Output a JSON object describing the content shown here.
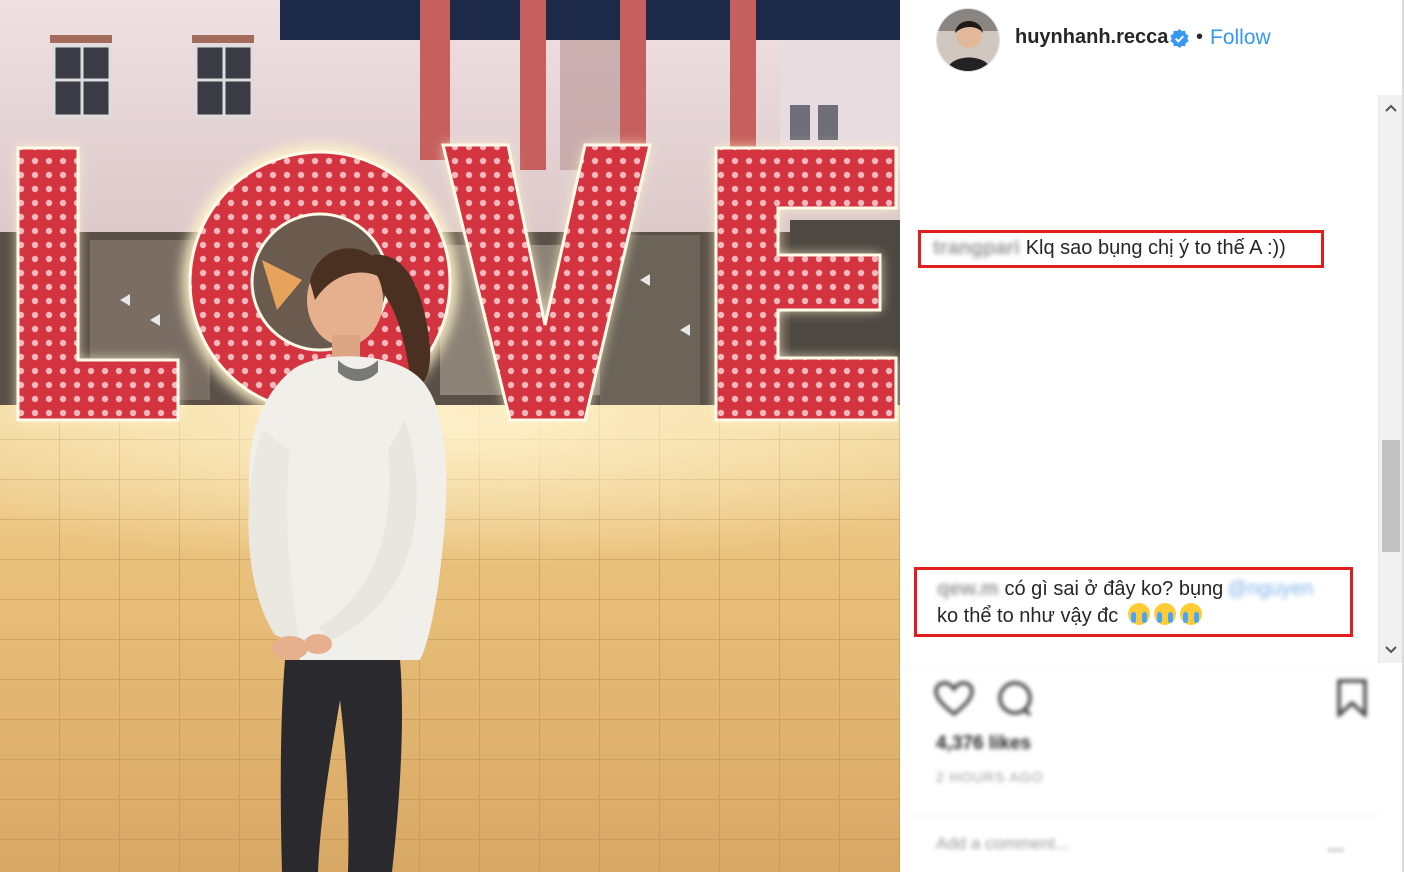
{
  "photo": {
    "sign_letters": [
      "L",
      "O",
      "V",
      "E"
    ],
    "palette": {
      "neon_red": "#d9333b",
      "glow": "#fff3c8",
      "floor": "#e8c07d",
      "building": "#e6cfcf",
      "sky": "#3a4a7a"
    }
  },
  "header": {
    "username": "huynhanh.recca",
    "separator": "•",
    "follow_label": "Follow",
    "verified_icon": "verified-badge-icon",
    "follow_color": "#3897f0"
  },
  "comments": [
    {
      "author": "trangpari",
      "text": "Klq sao bụng chị ý to thế A :))",
      "highlight_color": "#e11d1d"
    },
    {
      "author": "qew.m",
      "text_line1": "có gì sai ở đây ko? bụng",
      "mention": "@nguyen",
      "text_line2": "ko thể to như vậy đc",
      "emojis": [
        "loudly-crying-face",
        "loudly-crying-face",
        "loudly-crying-face"
      ],
      "highlight_color": "#e11d1d"
    }
  ],
  "actions": {
    "like_icon": "heart-icon",
    "comment_icon": "comment-bubble-icon",
    "save_icon": "bookmark-icon",
    "likes_text": "4,376 likes",
    "time_text": "2 HOURS AGO",
    "add_comment_placeholder": "Add a comment...",
    "more_label": "..."
  },
  "scrollbar": {
    "up_icon": "chevron-up-icon",
    "down_icon": "chevron-down-icon"
  }
}
